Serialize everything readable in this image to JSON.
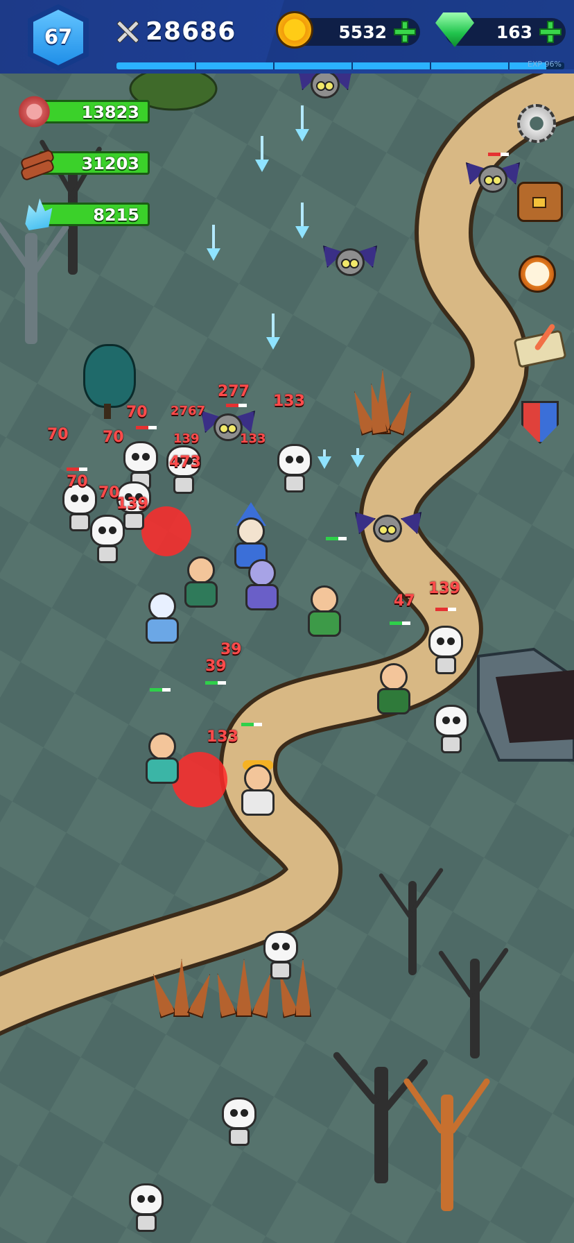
{
  "hud": {
    "level": "67",
    "power": "28686",
    "coins": "5532",
    "gems": "163",
    "exp_label": "EXP 96%",
    "exp_fraction": 0.96,
    "resources": [
      {
        "name": "meat",
        "icon": "meat-icon",
        "value": "13823"
      },
      {
        "name": "wood",
        "icon": "wood-icon",
        "value": "31203"
      },
      {
        "name": "crystal",
        "icon": "crystal-icon",
        "value": "8215"
      }
    ]
  },
  "side_menu": [
    {
      "icon": "gear-icon",
      "name": "settings-button"
    },
    {
      "icon": "backpack-icon",
      "name": "inventory-button"
    },
    {
      "icon": "compass-icon",
      "name": "explore-button"
    },
    {
      "icon": "quest-scroll-icon",
      "name": "quests-button"
    },
    {
      "icon": "shield-swords-icon",
      "name": "battle-button"
    }
  ],
  "damage_numbers": [
    "70",
    "70",
    "70",
    "70",
    "70",
    "277",
    "133",
    "133",
    "139",
    "139",
    "139",
    "473",
    "47",
    "39",
    "39",
    "133",
    "2767"
  ],
  "colors": {
    "hud_bg": "#1d3a88",
    "exp_fill": "#2bb2ff",
    "resource_bar": "#3bd12a",
    "damage_text": "#ff4b4b",
    "ground": "#4f6b66",
    "path": "#d8b884"
  }
}
